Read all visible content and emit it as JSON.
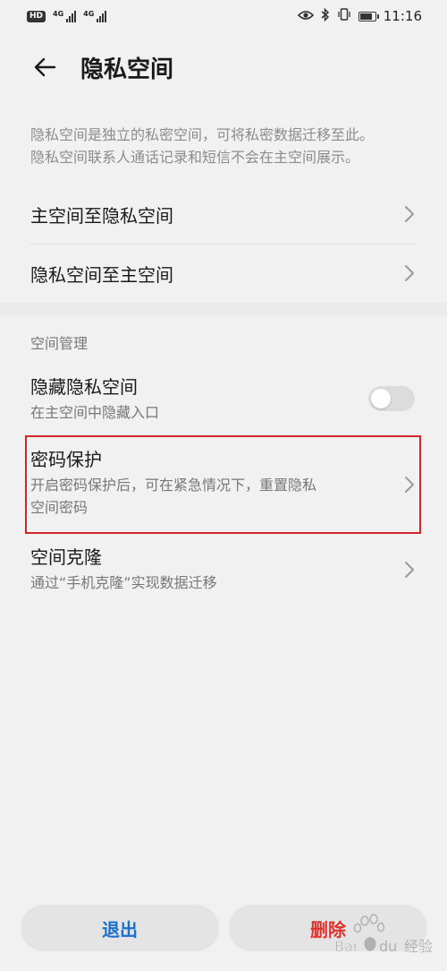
{
  "status_bar": {
    "hd_label": "HD",
    "network_1": "4G",
    "network_2": "4G",
    "time": "11:16",
    "battery_level": 0.85
  },
  "header": {
    "title": "隐私空间",
    "back_icon": "arrow-left-icon"
  },
  "description": {
    "line1": "隐私空间是独立的私密空间，可将私密数据迁移至此。",
    "line2": "隐私空间联系人通话记录和短信不会在主空间展示。"
  },
  "migration": {
    "items": [
      {
        "label": "主空间至隐私空间"
      },
      {
        "label": "隐私空间至主空间"
      }
    ]
  },
  "management": {
    "section_title": "空间管理",
    "hide_space": {
      "title": "隐藏隐私空间",
      "desc": "在主空间中隐藏入口",
      "enabled": false
    },
    "password_protect": {
      "title": "密码保护",
      "desc_line1": "开启密码保护后，可在紧急情况下，重置隐私",
      "desc_line2": "空间密码"
    },
    "space_clone": {
      "title": "空间克隆",
      "desc": "通过“手机克隆”实现数据迁移"
    }
  },
  "bottom": {
    "exit_label": "退出",
    "delete_label": "删除"
  },
  "watermark": {
    "text": "Bai du 经验"
  },
  "colors": {
    "background": "#f1f1f1",
    "exit_blue": "#1a6fd1",
    "delete_red": "#e0302a",
    "highlight_red": "#d0262b"
  }
}
